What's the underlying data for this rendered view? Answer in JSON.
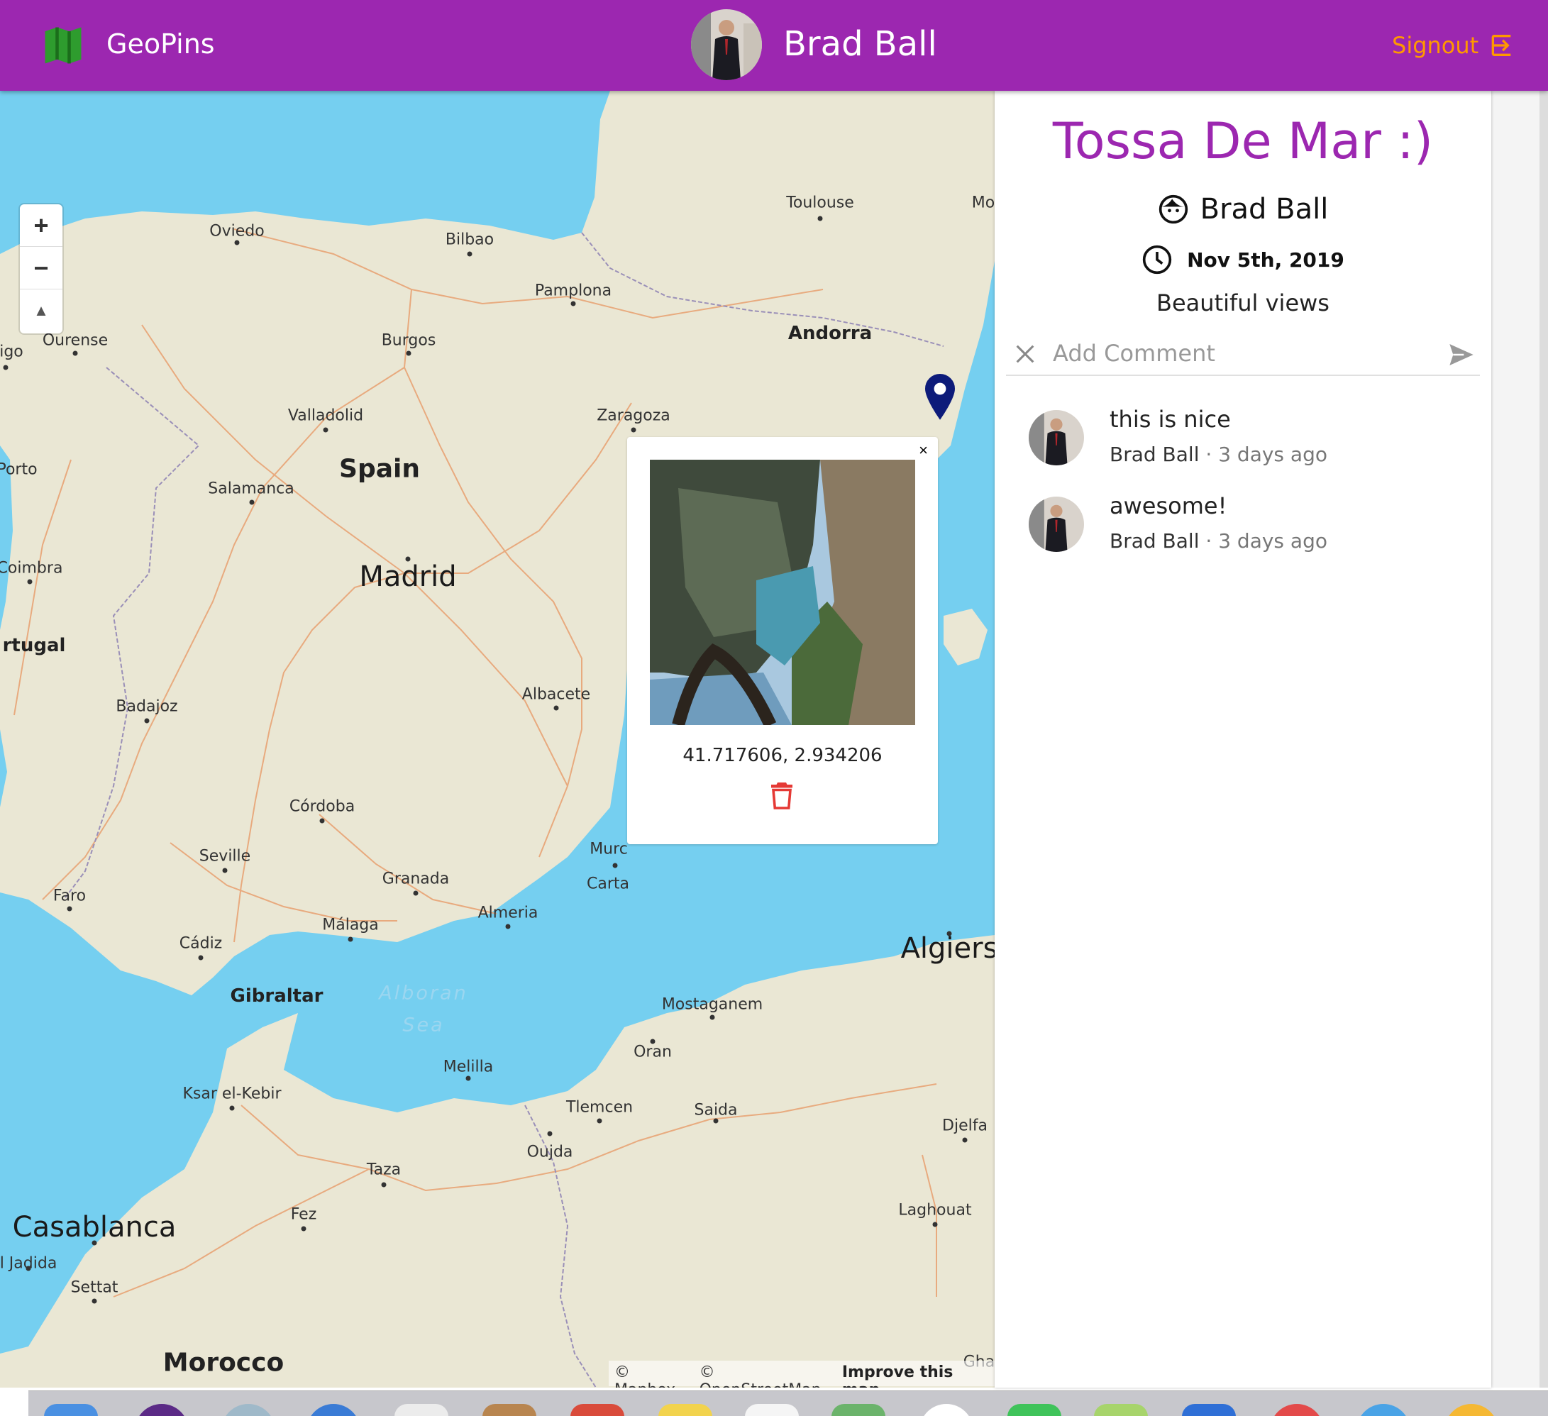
{
  "header": {
    "app_title": "GeoPins",
    "user_name": "Brad Ball",
    "signout_label": "Signout"
  },
  "map": {
    "labels": [
      {
        "text": "Toulouse",
        "kind": "city"
      },
      {
        "text": "Mo",
        "kind": "city"
      },
      {
        "text": "Oviedo",
        "kind": "city"
      },
      {
        "text": "Bilbao",
        "kind": "city"
      },
      {
        "text": "Pamplona",
        "kind": "city"
      },
      {
        "text": "Andorra",
        "kind": "mid"
      },
      {
        "text": "Ourense",
        "kind": "city"
      },
      {
        "text": "igo",
        "kind": "city"
      },
      {
        "text": "Burgos",
        "kind": "city"
      },
      {
        "text": "Valladolid",
        "kind": "city"
      },
      {
        "text": "Zaragoza",
        "kind": "city"
      },
      {
        "text": "Spain",
        "kind": "big"
      },
      {
        "text": "Porto",
        "kind": "city"
      },
      {
        "text": "Salamanca",
        "kind": "city"
      },
      {
        "text": "Coimbra",
        "kind": "city"
      },
      {
        "text": "Madrid",
        "kind": "country"
      },
      {
        "text": "rtugal",
        "kind": "mid"
      },
      {
        "text": "Badajoz",
        "kind": "city"
      },
      {
        "text": "Albacete",
        "kind": "city"
      },
      {
        "text": "Córdoba",
        "kind": "city"
      },
      {
        "text": "Murc",
        "kind": "city"
      },
      {
        "text": "Carta",
        "kind": "city"
      },
      {
        "text": "Seville",
        "kind": "city"
      },
      {
        "text": "Granada",
        "kind": "city"
      },
      {
        "text": "Faro",
        "kind": "city"
      },
      {
        "text": "Almeria",
        "kind": "city"
      },
      {
        "text": "Málaga",
        "kind": "city"
      },
      {
        "text": "Cádiz",
        "kind": "city"
      },
      {
        "text": "Algiers",
        "kind": "country"
      },
      {
        "text": "Gibraltar",
        "kind": "mid"
      },
      {
        "text": "Alboran",
        "kind": "sea"
      },
      {
        "text": "Sea",
        "kind": "sea"
      },
      {
        "text": "Mostaganem",
        "kind": "city"
      },
      {
        "text": "Oran",
        "kind": "city"
      },
      {
        "text": "Melilla",
        "kind": "city"
      },
      {
        "text": "Ksar el-Kebir",
        "kind": "city"
      },
      {
        "text": "Tlemcen",
        "kind": "city"
      },
      {
        "text": "Saida",
        "kind": "city"
      },
      {
        "text": "Djelfa",
        "kind": "city"
      },
      {
        "text": "Oujda",
        "kind": "city"
      },
      {
        "text": "Taza",
        "kind": "city"
      },
      {
        "text": "Fez",
        "kind": "city"
      },
      {
        "text": "Laghouat",
        "kind": "city"
      },
      {
        "text": "Casablanca",
        "kind": "country"
      },
      {
        "text": "l Jadida",
        "kind": "city"
      },
      {
        "text": "Settat",
        "kind": "city"
      },
      {
        "text": "Morocco",
        "kind": "big"
      },
      {
        "text": "Gha",
        "kind": "city"
      }
    ],
    "controls": {
      "zoom_in": "+",
      "zoom_out": "−",
      "compass": "▲"
    },
    "mapbox_logo": "mapbox",
    "attribution": {
      "mapbox": "© Mapbox",
      "osm": "© OpenStreetMap",
      "improve": "Improve this map"
    }
  },
  "popup": {
    "close": "×",
    "coordinates": "41.717606, 2.934206"
  },
  "panel": {
    "title": "Tossa De Mar :)",
    "author": "Brad Ball",
    "date": "Nov 5th, 2019",
    "description": "Beautiful views",
    "comment_placeholder": "Add Comment",
    "comments": [
      {
        "text": "this is nice",
        "author": "Brad Ball",
        "separator": "·",
        "time": "3 days ago"
      },
      {
        "text": "awesome!",
        "author": "Brad Ball",
        "separator": "·",
        "time": "3 days ago"
      }
    ]
  },
  "colors": {
    "header": "#9c27b0",
    "signout": "#ff9800",
    "water": "#75cff0",
    "land": "#eae7d4",
    "pin": "#0d1b7a",
    "delete": "#e53935"
  },
  "icons": [
    "map-icon",
    "signout-icon",
    "face-icon",
    "clock-icon",
    "close-icon",
    "send-icon",
    "pin-icon",
    "trash-icon"
  ]
}
